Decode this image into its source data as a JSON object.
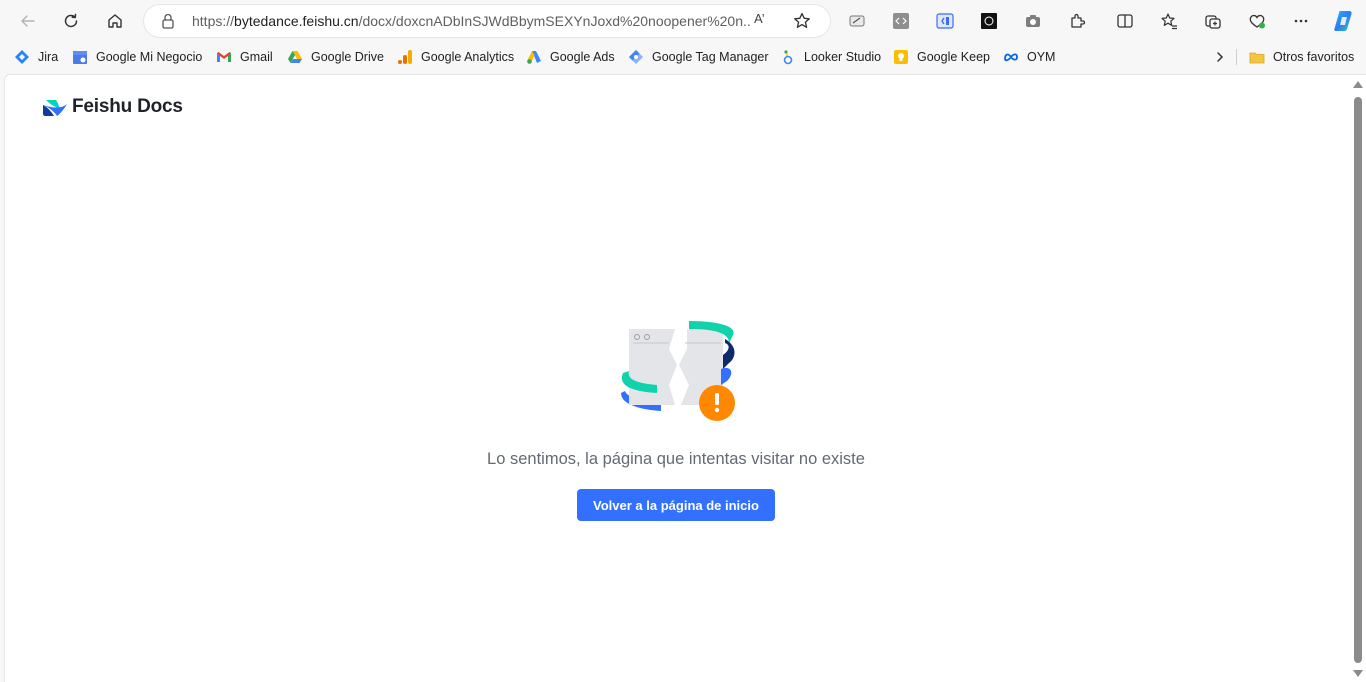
{
  "browser": {
    "address_bar": {
      "url_prefix": "https://",
      "url_host": "bytedance.feishu.cn",
      "url_rest": "/docx/doxcnADbInSJWdBbymSEXYnJoxd%20noopener%20n..."
    },
    "read_aloud_label": "A’"
  },
  "bookmarks": [
    {
      "label": "Jira",
      "icon": "jira-icon"
    },
    {
      "label": "Google Mi Negocio",
      "icon": "google-my-business-icon"
    },
    {
      "label": "Gmail",
      "icon": "gmail-icon"
    },
    {
      "label": "Google Drive",
      "icon": "google-drive-icon"
    },
    {
      "label": "Google Analytics",
      "icon": "google-analytics-icon"
    },
    {
      "label": "Google Ads",
      "icon": "google-ads-icon"
    },
    {
      "label": "Google Tag Manager",
      "icon": "google-tag-manager-icon"
    },
    {
      "label": "Looker Studio",
      "icon": "looker-studio-icon"
    },
    {
      "label": "Google Keep",
      "icon": "google-keep-icon"
    },
    {
      "label": "OYM",
      "icon": "meta-icon"
    }
  ],
  "other_favorites": "Otros favoritos",
  "page": {
    "logo_text": "Feishu Docs",
    "message": "Lo sentimos, la página que intentas visitar no existe",
    "home_button": "Volver a la página de inicio"
  },
  "colors": {
    "accent": "#3370ff",
    "warning": "#ff8800",
    "teal": "#12d2ac",
    "navy": "#0e2a6b"
  }
}
